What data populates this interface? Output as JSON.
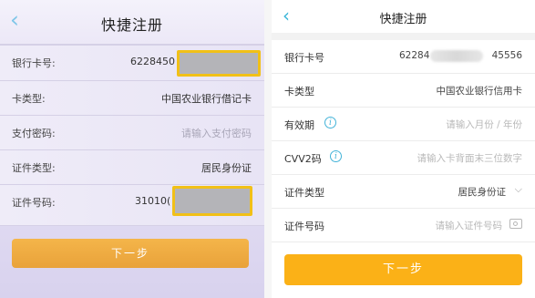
{
  "left": {
    "title": "快捷注册",
    "fields": {
      "card_number": {
        "label": "银行卡号:",
        "value_prefix": "6228450"
      },
      "card_type": {
        "label": "卡类型:",
        "value": "中国农业银行借记卡"
      },
      "pay_password": {
        "label": "支付密码:",
        "placeholder": "请输入支付密码"
      },
      "id_type": {
        "label": "证件类型:",
        "value": "居民身份证"
      },
      "id_number": {
        "label": "证件号码:",
        "value_prefix": "31010("
      }
    },
    "next_button": "下一步",
    "colors": {
      "mask_border": "#f1c017",
      "button": "#e9a23a",
      "back_arrow": "#7fc6e8"
    }
  },
  "right": {
    "title": "快捷注册",
    "fields": {
      "card_number": {
        "label": "银行卡号",
        "value_prefix": "62284",
        "value_suffix": "45556"
      },
      "card_type": {
        "label": "卡类型",
        "value": "中国农业银行信用卡"
      },
      "expiry": {
        "label": "有效期",
        "placeholder": "请输入月份 / 年份"
      },
      "cvv2": {
        "label": "CVV2码",
        "placeholder": "请输入卡背面末三位数字"
      },
      "id_type": {
        "label": "证件类型",
        "value": "居民身份证"
      },
      "id_number": {
        "label": "证件号码",
        "placeholder": "请输入证件号码"
      }
    },
    "info_glyph": "i",
    "next_button": "下一步",
    "colors": {
      "button": "#fbb117",
      "back_arrow": "#3ab6d8",
      "info": "#43b3d8"
    }
  },
  "icons": [
    "back-arrow-icon",
    "info-icon",
    "chevron-down-icon",
    "camera-icon"
  ]
}
